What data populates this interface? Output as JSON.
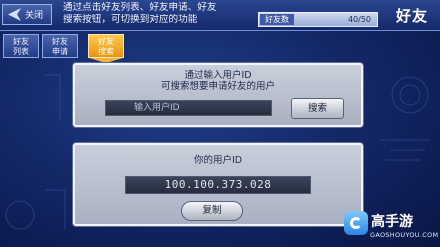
{
  "header": {
    "close_label": "关闭",
    "hint_lines": [
      "通过点击好友列表、好友申请、好友",
      "搜索按钮，可切换到对应的功能"
    ],
    "friend_count_label": "好友数",
    "friend_count_value": "40/50",
    "section_title": "好友"
  },
  "tabs": [
    {
      "line1": "好友",
      "line2": "列表",
      "active": false
    },
    {
      "line1": "好友",
      "line2": "申请",
      "active": false
    },
    {
      "line1": "好友",
      "line2": "搜索",
      "active": true
    }
  ],
  "search_panel": {
    "title_line1": "通过输入用户ID",
    "title_line2": "可搜索想要申请好友的用户",
    "input_placeholder": "输入用户ID",
    "search_button": "搜索"
  },
  "id_panel": {
    "title": "你的用户ID",
    "user_id": "100.100.373.028",
    "copy_button": "复制"
  },
  "watermark": {
    "name": "高手游",
    "url": "GAOSHOUYOU.COM"
  },
  "colors": {
    "background": "#14296a",
    "active_tab": "#f2b23b",
    "panel": "#c9cfda"
  }
}
